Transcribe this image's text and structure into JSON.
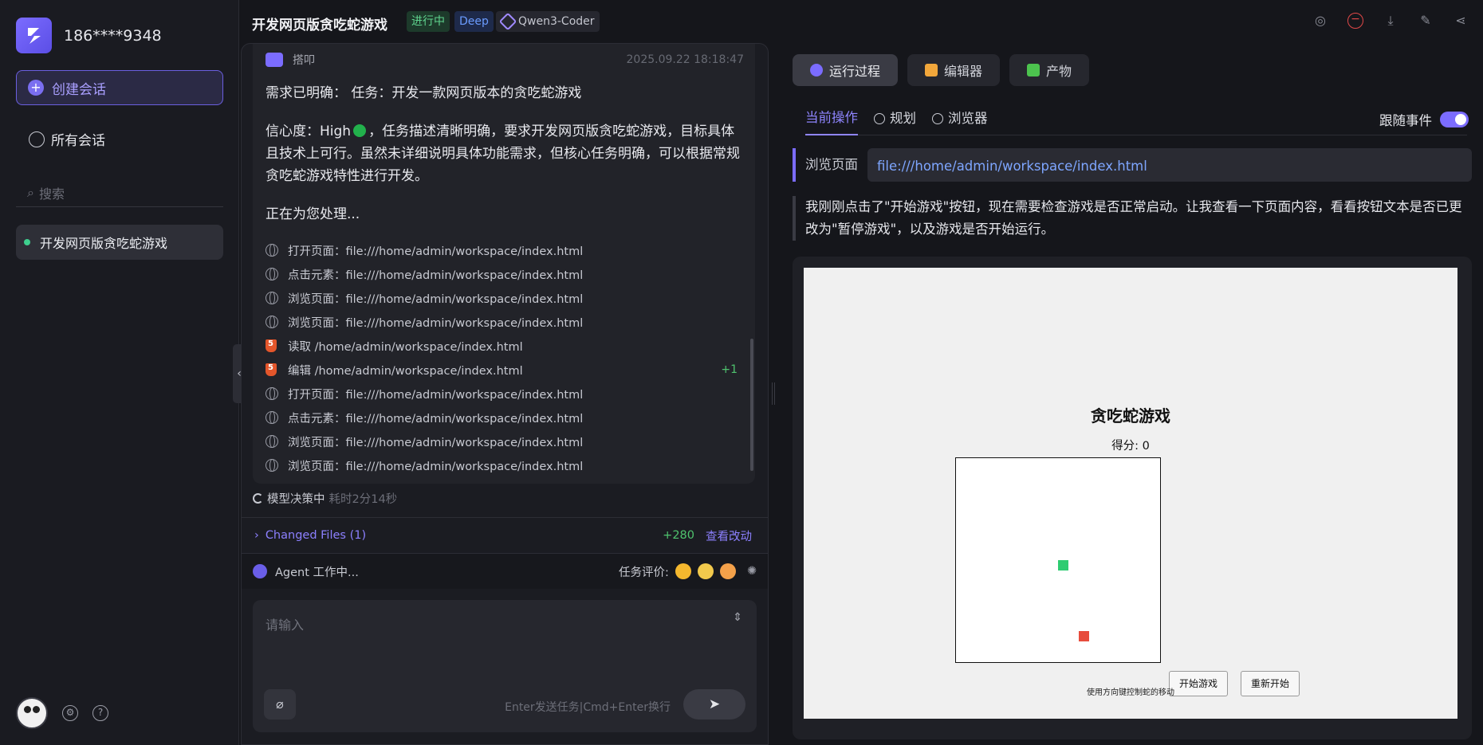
{
  "sidebar": {
    "username": "186****9348",
    "new_chat": "创建会话",
    "all_chats": "所有会话",
    "search_placeholder": "搜索",
    "session": "开发网页版贪吃蛇游戏"
  },
  "header": {
    "title": "开发网页版贪吃蛇游戏",
    "status": "进行中",
    "mode": "Deep",
    "model": "Qwen3-Coder"
  },
  "chat": {
    "agent_name": "搭叩",
    "timestamp": "2025.09.22 18:18:47",
    "p1": "需求已明确： 任务：开发一款网页版本的贪吃蛇游戏",
    "p2_prefix": "信心度：High",
    "p2_rest": "，任务描述清晰明确，要求开发网页版贪吃蛇游戏，目标具体且技术上可行。虽然未详细说明具体功能需求，但核心任务明确，可以根据常规贪吃蛇游戏特性进行开发。",
    "p3": "正在为您处理...",
    "steps": [
      {
        "icon": "globe",
        "text": "打开页面：file:///home/admin/workspace/index.html"
      },
      {
        "icon": "globe",
        "text": "点击元素：file:///home/admin/workspace/index.html"
      },
      {
        "icon": "globe",
        "text": "浏览页面：file:///home/admin/workspace/index.html"
      },
      {
        "icon": "globe",
        "text": "浏览页面：file:///home/admin/workspace/index.html"
      },
      {
        "icon": "html",
        "text": "读取 /home/admin/workspace/index.html"
      },
      {
        "icon": "html",
        "text": "编辑 /home/admin/workspace/index.html",
        "badge": "+1"
      },
      {
        "icon": "globe",
        "text": "打开页面：file:///home/admin/workspace/index.html"
      },
      {
        "icon": "globe",
        "text": "点击元素：file:///home/admin/workspace/index.html"
      },
      {
        "icon": "globe",
        "text": "浏览页面：file:///home/admin/workspace/index.html"
      },
      {
        "icon": "globe",
        "text": "浏览页面：file:///home/admin/workspace/index.html"
      }
    ],
    "thinking": "模型决策中",
    "duration": "耗时2分14秒",
    "changed_files": "Changed Files (1)",
    "added_lines": "+280",
    "view_changes": "查看改动",
    "agent_status": "Agent 工作中...",
    "rating_label": "任务评价:",
    "input_placeholder": "请输入",
    "input_hint": "Enter发送任务|Cmd+Enter换行"
  },
  "right": {
    "tabs": [
      "运行过程",
      "编辑器",
      "产物"
    ],
    "subtabs": [
      "当前操作",
      "规划",
      "浏览器"
    ],
    "follow_label": "跟随事件",
    "browse_label": "浏览页面",
    "url": "file:///home/admin/workspace/index.html",
    "description": "我刚刚点击了\"开始游戏\"按钮，现在需要检查游戏是否正常启动。让我查看一下页面内容，看看按钮文本是否已更改为\"暂停游戏\"，以及游戏是否开始运行。"
  },
  "game": {
    "title": "贪吃蛇游戏",
    "score": "得分: 0",
    "start": "开始游戏",
    "restart": "重新开始",
    "hint": "使用方向键控制蛇的移动"
  },
  "colors": {
    "accent": "#7b6cff",
    "status_green": "#5fd38e",
    "snake": "#2ecc71",
    "food": "#e74c3c"
  }
}
